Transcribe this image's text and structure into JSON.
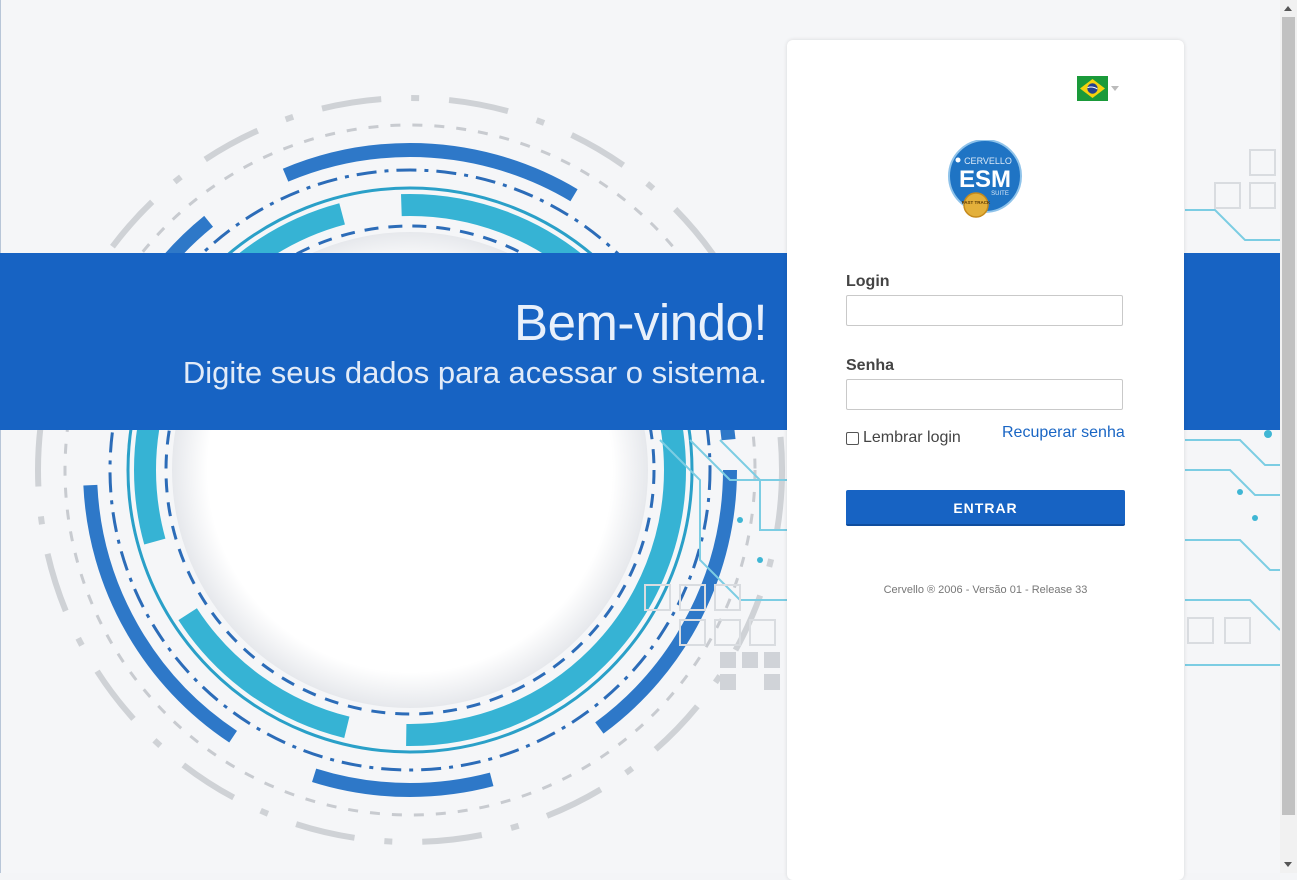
{
  "welcome": {
    "title": "Bem-vindo!",
    "subtitle": "Digite seus dados para acessar o sistema."
  },
  "language": {
    "selected": "Português (Brasil)",
    "icon": "brazil-flag-icon"
  },
  "logo": {
    "brand": "CERVELLO",
    "name": "ESM",
    "suffix": "SUITE",
    "badge": "FAST TRACK"
  },
  "form": {
    "login_label": "Login",
    "login_value": "",
    "password_label": "Senha",
    "password_value": "",
    "remember_label": "Lembrar login",
    "remember_checked": false,
    "recover_link": "Recuperar senha",
    "submit_label": "ENTRAR"
  },
  "footer": {
    "text": "Cervello ® 2006 - Versão 01 - Release 33"
  },
  "colors": {
    "primary": "#1763c3",
    "accent_cyan": "#3fb6d4",
    "link": "#1a66c4"
  }
}
